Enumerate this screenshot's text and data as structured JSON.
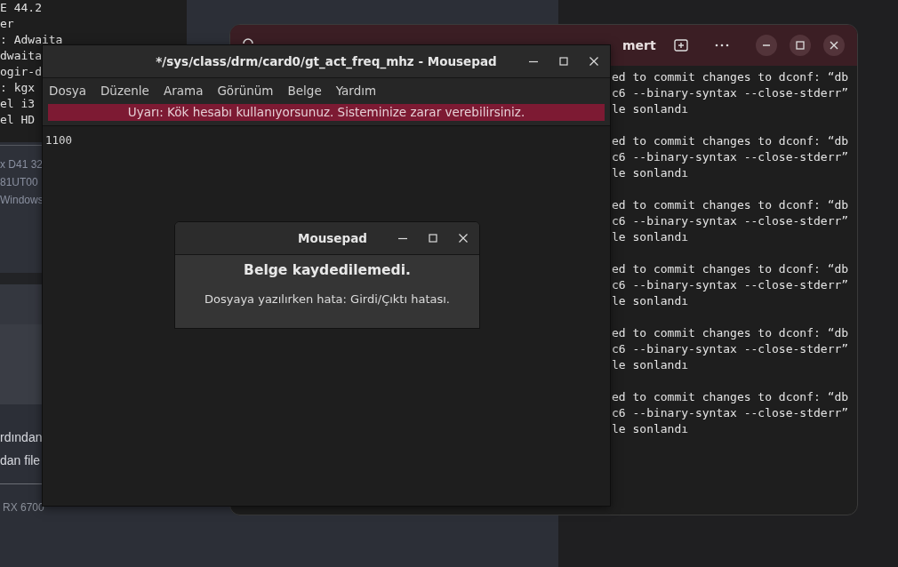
{
  "background_terminal": {
    "lines": [
      "E 44.2",
      "er",
      ": Adwaita",
      "dwaita",
      "ogir-d",
      ": kgx",
      "el i3",
      "el HD"
    ]
  },
  "web_page": {
    "spec_lines": [
      "x D41 32",
      "81UT00",
      "Windows"
    ],
    "body_lines": [
      "rdından",
      "dan file"
    ],
    "footer": "RX 6700"
  },
  "terminal": {
    "title": "mert",
    "blocks": [
      [
        "ed to commit changes to dconf: “db",
        "c6 --binary-syntax --close-stderr”",
        "le sonlandı"
      ],
      [
        "ed to commit changes to dconf: “db",
        "c6 --binary-syntax --close-stderr”",
        "le sonlandı"
      ],
      [
        "ed to commit changes to dconf: “db",
        "c6 --binary-syntax --close-stderr”",
        "le sonlandı"
      ],
      [
        "ed to commit changes to dconf: “db",
        "c6 --binary-syntax --close-stderr”",
        "le sonlandı"
      ],
      [
        "ed to commit changes to dconf: “db",
        "c6 --binary-syntax --close-stderr”",
        "le sonlandı"
      ],
      [
        "ed to commit changes to dconf: “db",
        "c6 --binary-syntax --close-stderr”",
        "le sonlandı"
      ]
    ]
  },
  "editor": {
    "title": "*/sys/class/drm/card0/gt_act_freq_mhz - Mousepad",
    "menu": [
      "Dosya",
      "Düzenle",
      "Arama",
      "Görünüm",
      "Belge",
      "Yardım"
    ],
    "warning": "Uyarı: Kök hesabı kullanıyorsunuz. Sisteminize zarar verebilirsiniz.",
    "content": "1100"
  },
  "dialog": {
    "title": "Mousepad",
    "heading": "Belge kaydedilemedi.",
    "message": "Dosyaya yazılırken hata: Girdi/Çıktı hatası."
  }
}
